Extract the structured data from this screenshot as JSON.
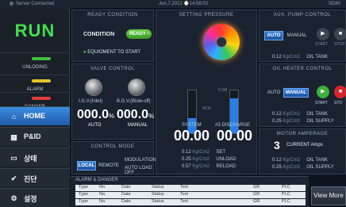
{
  "statusbar": {
    "connection": "Server Connected",
    "datetime": "Jun.7.2012  ⌚14:58:02",
    "code": "SD60"
  },
  "sidebar": {
    "run": "RUN",
    "indicators": [
      {
        "label": "UNLODING",
        "color": "#3fbf3f"
      },
      {
        "label": "ALARM",
        "color": "#e8c52a"
      },
      {
        "label": "DANGER",
        "color": "#e23b3b"
      }
    ],
    "nav": [
      {
        "label": "HOME",
        "icon": "home-icon",
        "glyph": "⌂"
      },
      {
        "label": "P&ID",
        "icon": "grid-icon",
        "glyph": "▦"
      },
      {
        "label": "상태",
        "icon": "monitor-icon",
        "glyph": "▭"
      },
      {
        "label": "진단",
        "icon": "check-icon",
        "glyph": "✔"
      },
      {
        "label": "설정",
        "icon": "gear-icon",
        "glyph": "⚙"
      }
    ]
  },
  "ready": {
    "title": "READY CONDITION",
    "condition_label": "CONDITION",
    "ready_button": "READY",
    "status": "EQUIOMENT TO START"
  },
  "valve": {
    "title": "VALVE CONTROL",
    "igv_label": "I.G.V.(Inlet)",
    "bov_label": "B.O.V.(Blow-off)",
    "igv_value": "000.0",
    "bov_value": "000.0",
    "unit": "%",
    "igv_mode": "AUTO",
    "bov_mode": "MANUAL"
  },
  "control_mode": {
    "title": "CONTROL MODE",
    "local": "LOCAL",
    "remote": "REMOTE",
    "modulation": "MODULATION",
    "auto_load_off": "AUTO LOAD OFF"
  },
  "pressure": {
    "title": "SETTING PRESSURE",
    "system_label": "SYSTEM",
    "discharge_label": "#3 DISCHARGE",
    "gauge_mid": "4CM",
    "gauge_top": "5.5M",
    "system_value": "00.00",
    "discharge_value": "00.00",
    "system_fill": 0.35,
    "discharge_fill": 0.82,
    "rows": [
      {
        "value": "0.12",
        "unit": "Kg/Cm2",
        "label": "SET"
      },
      {
        "value": "0.25",
        "unit": "Kg/Cm2",
        "label": "UNLOAD"
      },
      {
        "value": "0.57",
        "unit": "Kg/Cm2",
        "label": "RELOAD"
      }
    ]
  },
  "aux_pump": {
    "title": "AUX. PUMP CONTROL",
    "auto": "AUTO",
    "manual": "MANUAL",
    "start": "START",
    "stop": "STOP",
    "value": "0.12",
    "unit": "Kg/Cm2",
    "label": "OIL TANK"
  },
  "oil_heater": {
    "title": "OIL HEATER CONTROL",
    "auto": "AUTO",
    "manual": "MANUAL",
    "start": "START",
    "stop": "STO",
    "rows": [
      {
        "value": "0.12",
        "unit": "Kg/Cm2",
        "label": "OIL TANK"
      },
      {
        "value": "0.25",
        "unit": "Kg/Cm2",
        "label": "OIL SUPPLY"
      }
    ]
  },
  "motor": {
    "title": "MOTOR AMPERAGE",
    "value": "3",
    "label": "CURRENT Amps",
    "rows": [
      {
        "value": "0.12",
        "unit": "Kg/Cm2",
        "label": "OIL TANK"
      },
      {
        "value": "0.25",
        "unit": "Kg/Cm2",
        "label": "OIL SUPPLY"
      }
    ]
  },
  "alarm": {
    "title": "ALARM & DANGER",
    "rows": [
      {
        "type": "Type",
        "no": "No.",
        "date": "Date",
        "status": "Status",
        "text": "Text",
        "gr": "GR",
        "plc": "PLC"
      },
      {
        "type": "Type",
        "no": "No.",
        "date": "Date",
        "status": "Status",
        "text": "Text",
        "gr": "GR",
        "plc": "PLC"
      },
      {
        "type": "Type",
        "no": "No.",
        "date": "Date",
        "status": "Status",
        "text": "Text",
        "gr": "GR",
        "plc": "PLC"
      }
    ],
    "view_more": "View More"
  }
}
